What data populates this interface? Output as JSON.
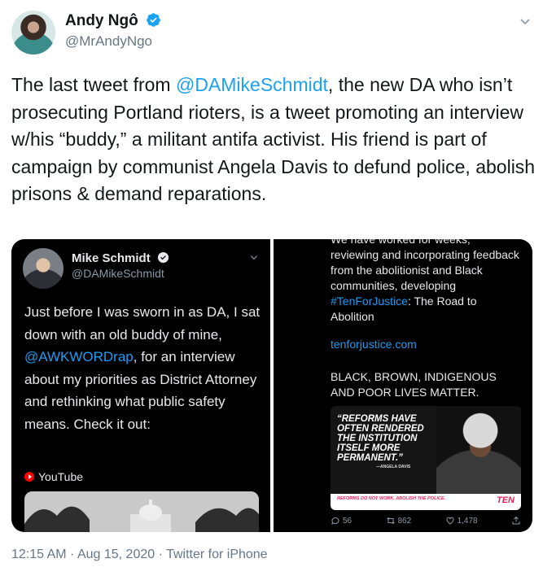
{
  "author": {
    "name": "Andy Ngô",
    "handle": "@MrAndyNgo"
  },
  "tweet": {
    "text_before": "The last tweet from ",
    "mention": "@DAMikeSchmidt",
    "text_after": ", the new DA who isn’t prosecuting Portland rioters, is a tweet promoting an interview w/his “buddy,” a militant antifa activist. His friend is part of campaign by communist Angela Davis to defund police, abolish prisons & demand reparations.",
    "timestamp": "12:15 AM · Aug 15, 2020",
    "source": "Twitter for iPhone",
    "separator": " · "
  },
  "media": {
    "left": {
      "name": "Mike Schmidt",
      "handle": "@DAMikeSchmidt",
      "text_before": "Just before I was sworn in as DA, I sat down with an old buddy of mine, ",
      "mention": "@AWKWORDrap",
      "text_after": ", for an interview about my priorities as District Attorney and rethinking what public safety means. Check it out:",
      "youtube_label": "YouTube"
    },
    "right": {
      "text_top": "We have worked for weeks, reviewing and incorporating feedback from the abolitionist and Black communities, developing ",
      "hashtag": "#TenForJustice",
      "text_top_after": ": The Road to Abolition",
      "link": "tenforjustice.com",
      "caps_text": "BLACK, BROWN, INDIGENOUS AND POOR LIVES MATTER.",
      "poster_quote": "“REFORMS HAVE OFTEN RENDERED THE INSTITUTION ITSELF MORE PERMANENT.”",
      "poster_attribution": "—ANGELA DAVIS",
      "poster_banner": "REFORMS DO NOT WORK. ABOLISH THE POLICE.",
      "poster_brand": "TEN",
      "reply_count": "56",
      "retweet_count": "862",
      "like_count": "1,478"
    }
  },
  "colors": {
    "accent": "#1da1f2",
    "text": "#14171a",
    "secondary": "#657786"
  }
}
